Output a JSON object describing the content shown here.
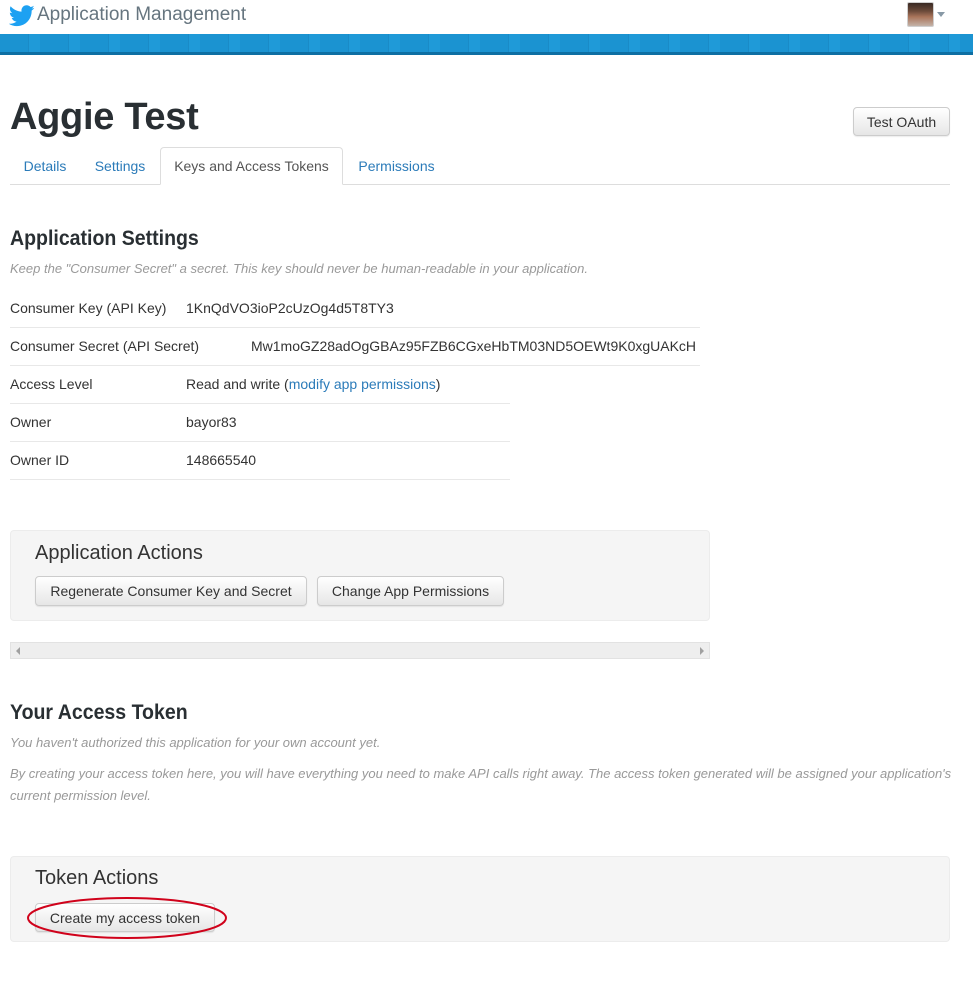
{
  "header": {
    "app_title": "Application Management",
    "brand_color": "#1da1f2",
    "stripe_color": "#1b93d1"
  },
  "app": {
    "name": "Aggie Test",
    "test_oauth_label": "Test OAuth"
  },
  "tabs": [
    {
      "label": "Details",
      "active": false
    },
    {
      "label": "Settings",
      "active": false
    },
    {
      "label": "Keys and Access Tokens",
      "active": true
    },
    {
      "label": "Permissions",
      "active": false
    }
  ],
  "app_settings": {
    "heading": "Application Settings",
    "note": "Keep the \"Consumer Secret\" a secret. This key should never be human-readable in your application.",
    "rows": [
      {
        "label": "Consumer Key (API Key)",
        "value": "1KnQdVO3ioP2cUzOg4d5T8TY3"
      },
      {
        "label": "Consumer Secret (API Secret)",
        "value": "Mw1moGZ28adOgGBAz95FZB6CGxeHbTM03ND5OEWt9K0xgUAKcH"
      },
      {
        "label": "Access Level",
        "value": "Read and write (",
        "link": "modify app permissions",
        "suffix": ")"
      },
      {
        "label": "Owner",
        "value": "bayor83"
      },
      {
        "label": "Owner ID",
        "value": "148665540"
      }
    ]
  },
  "app_actions": {
    "title": "Application Actions",
    "regenerate_label": "Regenerate Consumer Key and Secret",
    "change_permissions_label": "Change App Permissions"
  },
  "access_token": {
    "heading": "Your Access Token",
    "note1": "You haven't authorized this application for your own account yet.",
    "note2": "By creating your access token here, you will have everything you need to make API calls right away. The access token generated will be assigned your application's current permission level."
  },
  "token_actions": {
    "title": "Token Actions",
    "create_label": "Create my access token",
    "highlight_color": "#d0021b"
  },
  "icons": [
    "twitter-bird-icon",
    "avatar",
    "dropdown-caret-icon",
    "scroll-left-arrow-icon",
    "scroll-right-arrow-icon"
  ]
}
